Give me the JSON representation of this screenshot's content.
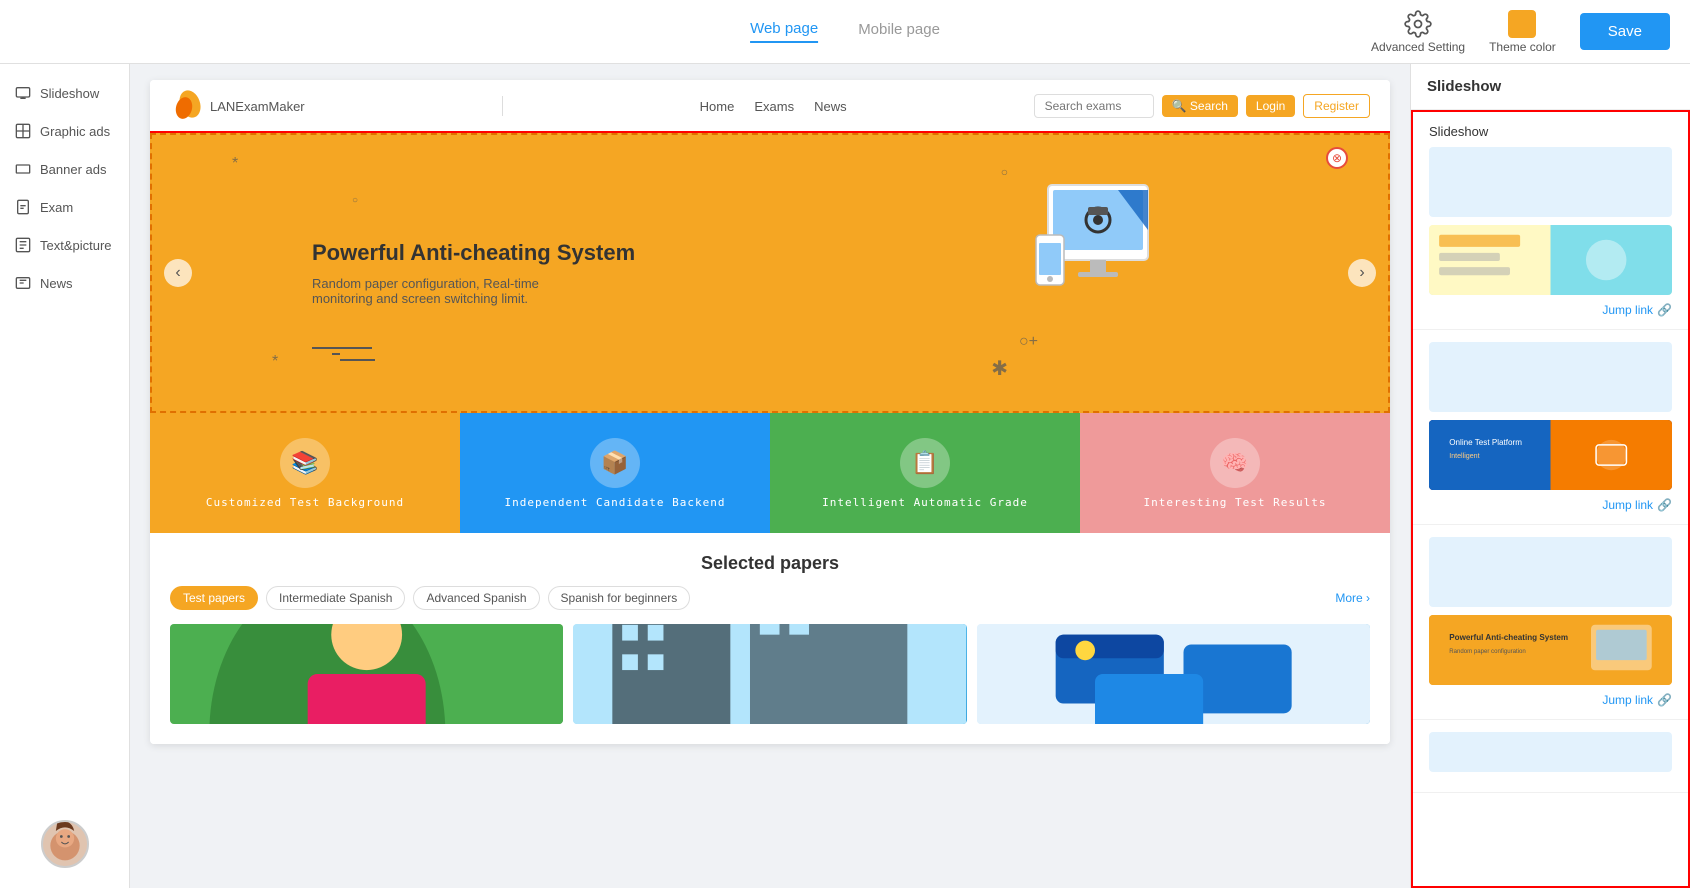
{
  "topbar": {
    "tabs": [
      {
        "id": "web",
        "label": "Web page",
        "active": true
      },
      {
        "id": "mobile",
        "label": "Mobile page",
        "active": false
      }
    ],
    "advanced_setting_label": "Advanced Setting",
    "theme_color_label": "Theme color",
    "theme_color_hex": "#f5a623",
    "save_label": "Save"
  },
  "sidebar": {
    "items": [
      {
        "id": "slideshow",
        "label": "Slideshow",
        "icon": "slideshow-icon"
      },
      {
        "id": "graphic-ads",
        "label": "Graphic ads",
        "icon": "graphic-ads-icon"
      },
      {
        "id": "banner-ads",
        "label": "Banner ads",
        "icon": "banner-ads-icon"
      },
      {
        "id": "exam",
        "label": "Exam",
        "icon": "exam-icon"
      },
      {
        "id": "text-picture",
        "label": "Text&picture",
        "icon": "text-picture-icon"
      },
      {
        "id": "news",
        "label": "News",
        "icon": "news-icon"
      }
    ]
  },
  "preview": {
    "nav": {
      "logo_text": "LANExamMaker",
      "links": [
        "Home",
        "Exams",
        "News"
      ],
      "search_placeholder": "Search exams",
      "search_btn": "🔍 Search",
      "login_btn": "Login",
      "register_btn": "Register"
    },
    "banner": {
      "title": "Powerful Anti-cheating System",
      "subtitle": "Random paper configuration, Real-time\nmonitoring and screen switching limit."
    },
    "feature_cards": [
      {
        "label": "Customized Test Background",
        "color": "fc-yellow",
        "icon": "📚"
      },
      {
        "label": "Independent Candidate Backend",
        "color": "fc-blue",
        "icon": "📦"
      },
      {
        "label": "Intelligent Automatic Grade",
        "color": "fc-green",
        "icon": "📋"
      },
      {
        "label": "Interesting Test Results",
        "color": "fc-pink",
        "icon": "🧠"
      }
    ],
    "selected_papers": {
      "title": "Selected papers",
      "tabs": [
        "Test papers",
        "Intermediate Spanish",
        "Advanced Spanish",
        "Spanish for beginners"
      ],
      "active_tab": 0,
      "more_label": "More >"
    }
  },
  "right_panel": {
    "title": "Slideshow",
    "options": [
      {
        "title": "Slideshow",
        "jump_link_label": "Jump link",
        "has_thumbnail": true,
        "thumb_type": "thumb-1"
      },
      {
        "title": "",
        "jump_link_label": "Jump link",
        "has_thumbnail": true,
        "thumb_type": "thumb-2"
      },
      {
        "title": "",
        "jump_link_label": "Jump link",
        "has_thumbnail": true,
        "thumb_type": "thumb-3"
      }
    ]
  }
}
